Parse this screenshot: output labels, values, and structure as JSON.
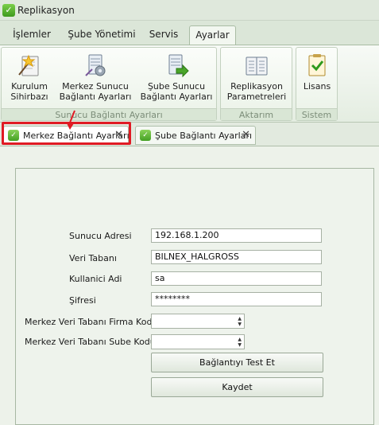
{
  "window": {
    "title": "Replikasyon",
    "icon": "app-leaf-icon"
  },
  "ribbon_tabs": [
    {
      "label": "İşlemler"
    },
    {
      "label": "Şube Yönetimi"
    },
    {
      "label": "Servis"
    },
    {
      "label": "Ayarlar",
      "active": true
    }
  ],
  "ribbon": {
    "groups": [
      {
        "label": "Sunucu Bağlantı Ayarları",
        "buttons": [
          {
            "line1": "Kurulum",
            "line2": "Sihirbazı",
            "icon": "wizard-icon"
          },
          {
            "line1": "Merkez Sunucu",
            "line2": "Bağlantı Ayarları",
            "icon": "server-settings-icon"
          },
          {
            "line1": "Şube Sunucu",
            "line2": "Bağlantı Ayarları",
            "icon": "server-connect-icon"
          }
        ]
      },
      {
        "label": "Aktarım",
        "buttons": [
          {
            "line1": "Replikasyon",
            "line2": "Parametreleri",
            "icon": "parameters-icon"
          }
        ]
      },
      {
        "label": "Sistem",
        "buttons": [
          {
            "line1": "Lisans",
            "line2": "",
            "icon": "license-icon"
          }
        ]
      }
    ]
  },
  "doc_tabs": [
    {
      "label": "Merkez Bağlantı Ayarları",
      "active": true,
      "highlighted": true
    },
    {
      "label": "Şube Bağlantı Ayarları",
      "active": false
    }
  ],
  "form": {
    "fields": [
      {
        "label": "Sunucu Adresi",
        "value": "192.168.1.200"
      },
      {
        "label": "Veri Tabanı",
        "value": "BILNEX_HALGROSS"
      },
      {
        "label": "Kullanici Adi",
        "value": "sa"
      },
      {
        "label": "Şifresi",
        "value": "********"
      },
      {
        "label": "Merkez Veri Tabanı Firma Kodu",
        "value": ""
      },
      {
        "label": "Merkez Veri Tabanı Sube Kodu",
        "value": ""
      }
    ],
    "test_button": "Bağlantıyı Test Et",
    "save_button": "Kaydet"
  },
  "colors": {
    "highlight": "#e01b24",
    "accent": "#4aa52a"
  }
}
